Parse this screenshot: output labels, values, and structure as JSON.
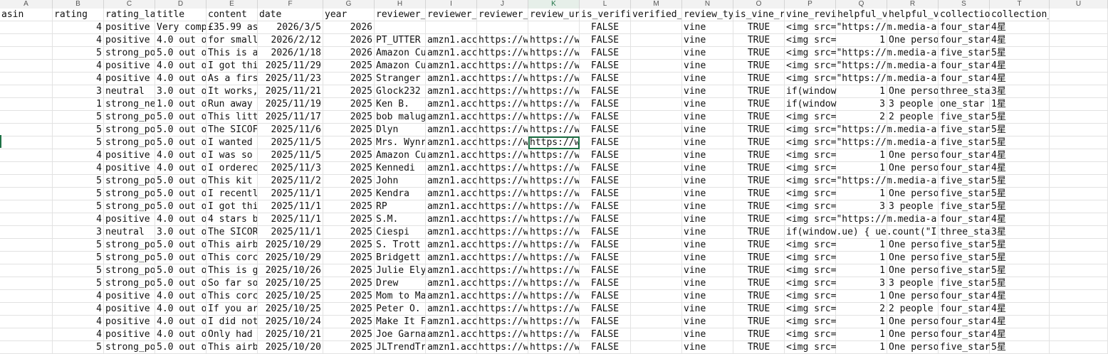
{
  "columns": [
    "A",
    "B",
    "C",
    "D",
    "E",
    "F",
    "G",
    "H",
    "I",
    "J",
    "K",
    "L",
    "M",
    "N",
    "O",
    "P",
    "Q",
    "R",
    "S",
    "T",
    "U"
  ],
  "active_column": "K",
  "headers": [
    "asin",
    "rating",
    "rating_la",
    "title",
    "content",
    "date",
    "year",
    "reviewer_",
    "reviewer_",
    "reviewer_",
    "review_ur",
    "is_verifi",
    "verified_",
    "review_ty",
    "is_vine_r",
    "vine_revi",
    "helpful_v",
    "helpful_v",
    "collectio",
    "collection_source_lab",
    ""
  ],
  "rows": [
    [
      "",
      "4",
      "positive",
      "Very comp",
      "£35.99 as",
      "2026/3/5",
      "2026",
      "",
      "",
      "",
      "",
      "FALSE",
      "",
      "vine",
      "TRUE",
      "<img src=\"https://m.media-a",
      "",
      "",
      "four_star",
      "4星"
    ],
    [
      "",
      "4",
      "positive",
      "4.0 out o",
      "for small",
      "2026/2/12",
      "2026",
      "PT_UTTER",
      "amzn1.acc",
      "https://w",
      "https://w",
      "FALSE",
      "",
      "vine",
      "TRUE",
      "<img src=",
      "1",
      "One perso",
      "four_star",
      "4星"
    ],
    [
      "",
      "5",
      "strong_po",
      "5.0 out o",
      "This is a",
      "2026/1/18",
      "2026",
      "Amazon Cu",
      "amzn1.acc",
      "https://w",
      "https://w",
      "FALSE",
      "",
      "vine",
      "TRUE",
      "<img src=\"https://m.media-a",
      "",
      "",
      "five_star",
      "5星"
    ],
    [
      "",
      "4",
      "positive",
      "4.0 out o",
      "I got thi",
      "2025/11/29",
      "2025",
      "Amazon Cu",
      "amzn1.acc",
      "https://w",
      "https://w",
      "FALSE",
      "",
      "vine",
      "TRUE",
      "<img src=\"https://m.media-a",
      "",
      "",
      "four_star",
      "4星"
    ],
    [
      "",
      "4",
      "positive",
      "4.0 out o",
      "As a firs",
      "2025/11/23",
      "2025",
      "Stranger",
      "amzn1.acc",
      "https://w",
      "https://w",
      "FALSE",
      "",
      "vine",
      "TRUE",
      "<img src=\"https://m.media-a",
      "",
      "",
      "four_star",
      "4星"
    ],
    [
      "",
      "3",
      "neutral",
      "3.0 out o",
      "It works,",
      "2025/11/21",
      "2025",
      "Glock232",
      "amzn1.acc",
      "https://w",
      "https://w",
      "FALSE",
      "",
      "vine",
      "TRUE",
      "if(window",
      "1",
      "One perso",
      "three_sta",
      "3星"
    ],
    [
      "",
      "1",
      "strong_ne",
      "1.0 out o",
      "Run away",
      "2025/11/19",
      "2025",
      "Ken B.",
      "amzn1.acc",
      "https://w",
      "https://w",
      "FALSE",
      "",
      "vine",
      "TRUE",
      "if(window",
      "3",
      "3 people",
      "one_star",
      "1星"
    ],
    [
      "",
      "5",
      "strong_po",
      "5.0 out o",
      "This litt",
      "2025/11/17",
      "2025",
      "bob malug",
      "amzn1.acc",
      "https://w",
      "https://w",
      "FALSE",
      "",
      "vine",
      "TRUE",
      "<img src=",
      "2",
      "2 people",
      "five_star",
      "5星"
    ],
    [
      "",
      "5",
      "strong_po",
      "5.0 out o",
      "The SICOF",
      "2025/11/6",
      "2025",
      "Dlyn",
      "amzn1.acc",
      "https://w",
      "https://w",
      "FALSE",
      "",
      "vine",
      "TRUE",
      "<img src=\"https://m.media-a",
      "",
      "",
      "five_star",
      "5星"
    ],
    [
      "",
      "5",
      "strong_po",
      "5.0 out o",
      "I wanted",
      "2025/11/5",
      "2025",
      "Mrs. Wynr",
      "amzn1.acc",
      "https://w",
      "https://w",
      "FALSE",
      "",
      "vine",
      "TRUE",
      "<img src=\"https://m.media-a",
      "",
      "",
      "five_star",
      "5星"
    ],
    [
      "",
      "4",
      "positive",
      "4.0 out o",
      "I was so",
      "2025/11/5",
      "2025",
      "Amazon Cu",
      "amzn1.acc",
      "https://w",
      "https://w",
      "FALSE",
      "",
      "vine",
      "TRUE",
      "<img src=",
      "1",
      "One perso",
      "four_star",
      "4星"
    ],
    [
      "",
      "4",
      "positive",
      "4.0 out o",
      "I orderec",
      "2025/11/3",
      "2025",
      "Kennedi",
      "amzn1.acc",
      "https://w",
      "https://w",
      "FALSE",
      "",
      "vine",
      "TRUE",
      "<img src=",
      "1",
      "One perso",
      "four_star",
      "4星"
    ],
    [
      "",
      "5",
      "strong_po",
      "5.0 out o",
      "This kit",
      "2025/11/2",
      "2025",
      "John",
      "amzn1.acc",
      "https://w",
      "https://w",
      "FALSE",
      "",
      "vine",
      "TRUE",
      "<img src=\"https://m.media-a",
      "",
      "",
      "five_star",
      "5星"
    ],
    [
      "",
      "5",
      "strong_po",
      "5.0 out o",
      "I recentl",
      "2025/11/1",
      "2025",
      "Kendra",
      "amzn1.acc",
      "https://w",
      "https://w",
      "FALSE",
      "",
      "vine",
      "TRUE",
      "<img src=",
      "1",
      "One perso",
      "five_star",
      "5星"
    ],
    [
      "",
      "5",
      "strong_po",
      "5.0 out o",
      "I got thi",
      "2025/11/1",
      "2025",
      "RP",
      "amzn1.acc",
      "https://w",
      "https://w",
      "FALSE",
      "",
      "vine",
      "TRUE",
      "<img src=",
      "3",
      "3 people",
      "five_star",
      "5星"
    ],
    [
      "",
      "4",
      "positive",
      "4.0 out o",
      "4 stars b",
      "2025/11/1",
      "2025",
      "S.M.",
      "amzn1.acc",
      "https://w",
      "https://w",
      "FALSE",
      "",
      "vine",
      "TRUE",
      "<img src=\"https://m.media-a",
      "",
      "",
      "four_star",
      "4星"
    ],
    [
      "",
      "3",
      "neutral",
      "3.0 out o",
      "The SICOR",
      "2025/11/1",
      "2025",
      "Ciespi",
      "amzn1.acc",
      "https://w",
      "https://w",
      "FALSE",
      "",
      "vine",
      "TRUE",
      "if(window.ue) { ue.count(\"I",
      "",
      "",
      "three_sta",
      "3星"
    ],
    [
      "",
      "5",
      "strong_po",
      "5.0 out o",
      "This airb",
      "2025/10/29",
      "2025",
      "S. Trott",
      "amzn1.acc",
      "https://w",
      "https://w",
      "FALSE",
      "",
      "vine",
      "TRUE",
      "<img src=",
      "1",
      "One perso",
      "five_star",
      "5星"
    ],
    [
      "",
      "5",
      "strong_po",
      "5.0 out o",
      "This corc",
      "2025/10/29",
      "2025",
      "Bridgett",
      "amzn1.acc",
      "https://w",
      "https://w",
      "FALSE",
      "",
      "vine",
      "TRUE",
      "<img src=",
      "1",
      "One perso",
      "five_star",
      "5星"
    ],
    [
      "",
      "5",
      "strong_po",
      "5.0 out o",
      "This is g",
      "2025/10/26",
      "2025",
      "Julie Ely",
      "amzn1.acc",
      "https://w",
      "https://w",
      "FALSE",
      "",
      "vine",
      "TRUE",
      "<img src=",
      "1",
      "One perso",
      "five_star",
      "5星"
    ],
    [
      "",
      "5",
      "strong_po",
      "5.0 out o",
      "So far so",
      "2025/10/25",
      "2025",
      "Drew",
      "amzn1.acc",
      "https://w",
      "https://w",
      "FALSE",
      "",
      "vine",
      "TRUE",
      "<img src=",
      "3",
      "3 people",
      "five_star",
      "5星"
    ],
    [
      "",
      "4",
      "positive",
      "4.0 out o",
      "This corc",
      "2025/10/25",
      "2025",
      "Mom to Ma",
      "amzn1.acc",
      "https://w",
      "https://w",
      "FALSE",
      "",
      "vine",
      "TRUE",
      "<img src=",
      "1",
      "One perso",
      "four_star",
      "4星"
    ],
    [
      "",
      "4",
      "positive",
      "4.0 out o",
      "If you ar",
      "2025/10/25",
      "2025",
      "Peter O.",
      "amzn1.acc",
      "https://w",
      "https://w",
      "FALSE",
      "",
      "vine",
      "TRUE",
      "<img src=",
      "2",
      "2 people",
      "four_star",
      "4星"
    ],
    [
      "",
      "4",
      "positive",
      "4.0 out o",
      "I did not",
      "2025/10/24",
      "2025",
      "Make It F",
      "amzn1.acc",
      "https://w",
      "https://w",
      "FALSE",
      "",
      "vine",
      "TRUE",
      "<img src=",
      "1",
      "One perso",
      "four_star",
      "4星"
    ],
    [
      "",
      "4",
      "positive",
      "4.0 out o",
      "Only had",
      "2025/10/21",
      "2025",
      "Joe Garna",
      "amzn1.acc",
      "https://w",
      "https://w",
      "FALSE",
      "",
      "vine",
      "TRUE",
      "<img src=",
      "1",
      "One perso",
      "four_star",
      "4星"
    ],
    [
      "",
      "5",
      "strong_po",
      "5.0 out o",
      "This airb",
      "2025/10/20",
      "2025",
      "JLTrendTr",
      "amzn1.acc",
      "https://w",
      "https://w",
      "FALSE",
      "",
      "vine",
      "TRUE",
      "<img src=",
      "1",
      "One perso",
      "five_star",
      "5星"
    ]
  ]
}
